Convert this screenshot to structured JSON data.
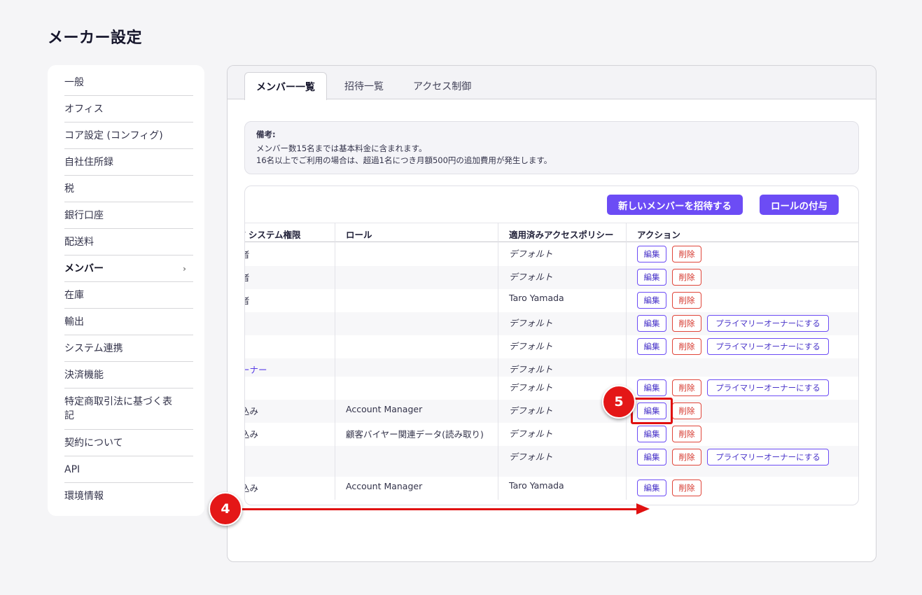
{
  "page": {
    "title": "メーカー設定"
  },
  "sidebar": {
    "items": [
      {
        "label": "一般"
      },
      {
        "label": "オフィス"
      },
      {
        "label": "コア設定 (コンフィグ)"
      },
      {
        "label": "自社住所録"
      },
      {
        "label": "税"
      },
      {
        "label": "銀行口座"
      },
      {
        "label": "配送料"
      },
      {
        "label": "メンバー",
        "active": true,
        "chevron": "›"
      },
      {
        "label": "在庫"
      },
      {
        "label": "輸出"
      },
      {
        "label": "システム連携"
      },
      {
        "label": "決済機能"
      },
      {
        "label": "特定商取引法に基づく表記"
      },
      {
        "label": "契約について"
      },
      {
        "label": "API"
      },
      {
        "label": "環境情報"
      }
    ]
  },
  "tabs": [
    {
      "label": "メンバー一覧",
      "active": true
    },
    {
      "label": "招待一覧"
    },
    {
      "label": "アクセス制御"
    }
  ],
  "note": {
    "heading": "備考:",
    "line1": "メンバー数15名までは基本料金に含まれます。",
    "line2": "16名以上でご利用の場合は、超過1名につき月額500円の追加費用が発生します。"
  },
  "actions": {
    "invite_label": "新しいメンバーを招待する",
    "assign_role_label": "ロールの付与"
  },
  "table": {
    "headers": [
      "/ システム権限",
      "ロール",
      "適用済みアクセスポリシー",
      "アクション"
    ],
    "edit_label": "編集",
    "delete_label": "削除",
    "owner_label": "プライマリーオーナーにする",
    "rows": [
      {
        "permission": "者",
        "role": "",
        "policy": "デフォルト",
        "policy_italic": true
      },
      {
        "permission": "者",
        "role": "",
        "policy": "デフォルト",
        "policy_italic": true
      },
      {
        "permission": "者",
        "role": "",
        "policy": "Taro Yamada",
        "policy_italic": false
      },
      {
        "permission": "",
        "role": "",
        "policy": "デフォルト",
        "policy_italic": true
      },
      {
        "permission": "",
        "role": "",
        "policy": "デフォルト",
        "policy_italic": true
      },
      {
        "permission": "ーナー",
        "role": "",
        "policy": "デフォルト",
        "policy_italic": true
      },
      {
        "permission": "",
        "role": "",
        "policy": "デフォルト",
        "policy_italic": true
      },
      {
        "permission": "込み",
        "role": "Account Manager",
        "policy": "デフォルト",
        "policy_italic": true
      },
      {
        "permission": "込み",
        "role": "顧客バイヤー関連データ(読み取り)",
        "policy": "デフォルト",
        "policy_italic": true
      },
      {
        "permission": "",
        "role": "",
        "policy": "デフォルト",
        "policy_italic": true
      },
      {
        "permission": "込み",
        "role": "Account Manager",
        "policy": "Taro Yamada",
        "policy_italic": false
      }
    ]
  },
  "annotations": {
    "step4": "4",
    "step5": "5",
    "color": "#e01010"
  },
  "colors": {
    "accent": "#6c4cf5",
    "danger": "#e0453a"
  }
}
